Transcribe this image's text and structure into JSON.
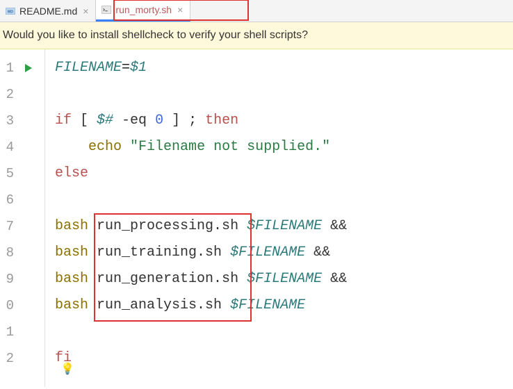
{
  "tabs": [
    {
      "label": "README.md",
      "active": false
    },
    {
      "label": "run_morty.sh",
      "active": true
    }
  ],
  "notification": "Would you like to install shellcheck to verify your shell scripts?",
  "gutter_lines": [
    "1",
    "2",
    "3",
    "4",
    "5",
    "6",
    "7",
    "8",
    "9",
    "0",
    "1",
    "2"
  ],
  "code": {
    "line1": {
      "var": "FILENAME",
      "eq": "=",
      "arg": "$1"
    },
    "line3": {
      "if": "if",
      "lb": " [ ",
      "darg": "$#",
      "op": " -eq ",
      "num": "0",
      "rb": " ] ",
      "semi": "; ",
      "then": "then"
    },
    "line4": {
      "indent": "    ",
      "echo": "echo",
      "sp": " ",
      "str": "\"Filename not supplied.\""
    },
    "line5": {
      "else": "else"
    },
    "line7": {
      "bash": "bash",
      "sp": " ",
      "script": "run_processing.sh",
      "sp2": " ",
      "var": "$FILENAME",
      "sp3": " ",
      "amp": "&&"
    },
    "line8": {
      "bash": "bash",
      "sp": " ",
      "script": "run_training.sh",
      "sp2": " ",
      "var": "$FILENAME",
      "sp3": " ",
      "amp": "&&"
    },
    "line9": {
      "bash": "bash",
      "sp": " ",
      "script": "run_generation.sh",
      "sp2": " ",
      "var": "$FILENAME",
      "sp3": " ",
      "amp": "&&"
    },
    "line10": {
      "bash": "bash",
      "sp": " ",
      "script": "run_analysis.sh",
      "sp2": " ",
      "var": "$FILENAME"
    },
    "line12": {
      "fi": "fi"
    }
  }
}
